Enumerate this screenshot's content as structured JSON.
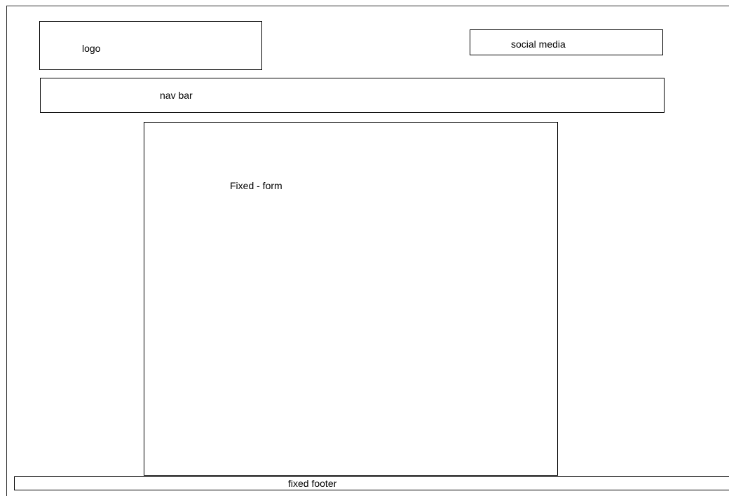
{
  "wireframe": {
    "logo_label": "logo",
    "social_media_label": "social media",
    "nav_bar_label": "nav bar",
    "form_label": "Fixed - form",
    "footer_label": "fixed footer"
  }
}
